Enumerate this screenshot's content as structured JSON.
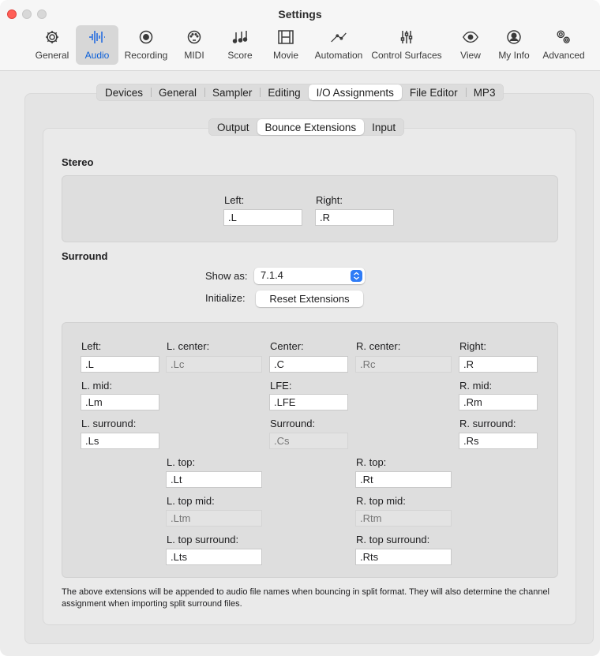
{
  "window": {
    "title": "Settings"
  },
  "toolbar": {
    "tabs": [
      {
        "label": "General",
        "icon": "gear-icon"
      },
      {
        "label": "Audio",
        "icon": "waveform-icon",
        "selected": true
      },
      {
        "label": "Recording",
        "icon": "record-icon"
      },
      {
        "label": "MIDI",
        "icon": "midi-port-icon"
      },
      {
        "label": "Score",
        "icon": "music-notes-icon"
      },
      {
        "label": "Movie",
        "icon": "film-icon"
      },
      {
        "label": "Automation",
        "icon": "automation-curve-icon"
      },
      {
        "label": "Control Surfaces",
        "icon": "faders-icon"
      },
      {
        "label": "View",
        "icon": "eye-icon"
      },
      {
        "label": "My Info",
        "icon": "person-icon"
      },
      {
        "label": "Advanced",
        "icon": "gears-icon"
      }
    ]
  },
  "audio_tabs": [
    "Devices",
    "General",
    "Sampler",
    "Editing",
    "I/O Assignments",
    "File Editor",
    "MP3"
  ],
  "audio_tabs_selected": "I/O Assignments",
  "io_tabs": [
    "Output",
    "Bounce Extensions",
    "Input"
  ],
  "io_tabs_selected": "Bounce Extensions",
  "stereo": {
    "title": "Stereo",
    "left_label": "Left:",
    "left_value": ".L",
    "right_label": "Right:",
    "right_value": ".R"
  },
  "surround": {
    "title": "Surround",
    "show_as_label": "Show as:",
    "show_as_value": "7.1.4",
    "initialize_label": "Initialize:",
    "reset_button": "Reset Extensions",
    "fields": {
      "left": {
        "label": "Left:",
        "value": ".L"
      },
      "l_center": {
        "label": "L. center:",
        "placeholder": ".Lc"
      },
      "center": {
        "label": "Center:",
        "value": ".C"
      },
      "r_center": {
        "label": "R. center:",
        "placeholder": ".Rc"
      },
      "right": {
        "label": "Right:",
        "value": ".R"
      },
      "l_mid": {
        "label": "L. mid:",
        "value": ".Lm"
      },
      "lfe": {
        "label": "LFE:",
        "value": ".LFE"
      },
      "r_mid": {
        "label": "R. mid:",
        "value": ".Rm"
      },
      "l_surround": {
        "label": "L. surround:",
        "value": ".Ls"
      },
      "surround": {
        "label": "Surround:",
        "placeholder": ".Cs"
      },
      "r_surround": {
        "label": "R. surround:",
        "value": ".Rs"
      },
      "l_top": {
        "label": "L. top:",
        "value": ".Lt"
      },
      "r_top": {
        "label": "R. top:",
        "value": ".Rt"
      },
      "l_top_mid": {
        "label": "L. top mid:",
        "placeholder": ".Ltm"
      },
      "r_top_mid": {
        "label": "R. top mid:",
        "placeholder": ".Rtm"
      },
      "l_top_surround": {
        "label": "L. top surround:",
        "value": ".Lts"
      },
      "r_top_surround": {
        "label": "R. top surround:",
        "value": ".Rts"
      }
    }
  },
  "footnote": "The above extensions will be appended to audio file names when bouncing in split format. They will also determine the channel assignment when importing split surround files.",
  "colors": {
    "accent": "#1a66e0",
    "close": "#ff5f57"
  }
}
